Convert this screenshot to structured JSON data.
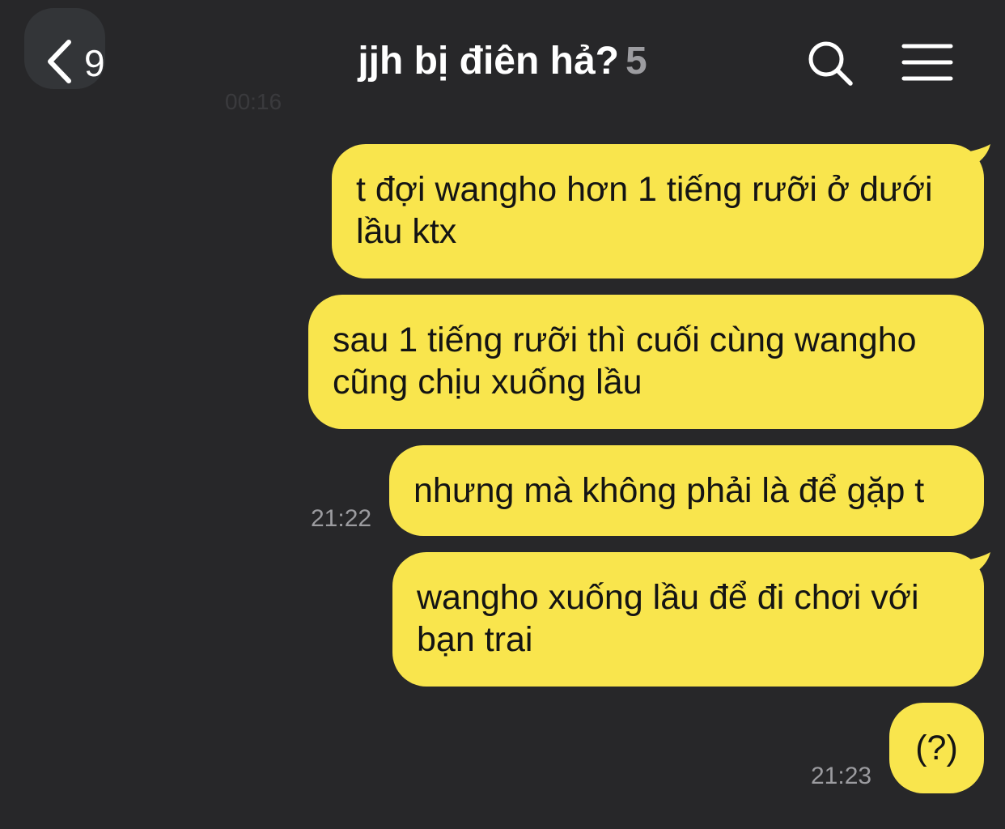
{
  "header": {
    "back_count": "9",
    "title": "jjh bị điên hả?",
    "member_count": "5"
  },
  "icons": {
    "back": "chevron-left-icon",
    "search": "search-icon",
    "menu": "hamburger-menu-icon"
  },
  "colors": {
    "background": "#272729",
    "my_bubble": "#f9e54d",
    "timestamp": "#9c9ca0"
  },
  "messages": [
    {
      "line1": "t đợi wangho hơn 1 tiếng rưỡi ở dưới",
      "line2": "lầu ktx",
      "time": ""
    },
    {
      "line1": "sau 1 tiếng rưỡi thì cuối cùng wangho",
      "line2": "cũng chịu xuống lầu",
      "time": ""
    },
    {
      "line1": "nhưng mà không phải là để gặp t",
      "line2": "",
      "time": "21:22"
    },
    {
      "line1": "wangho xuống lầu để đi chơi với",
      "line2": "bạn trai",
      "time": ""
    },
    {
      "line1": "(?)",
      "line2": "",
      "time": "21:23"
    }
  ],
  "faded_remnant": {
    "time": "00:16"
  }
}
